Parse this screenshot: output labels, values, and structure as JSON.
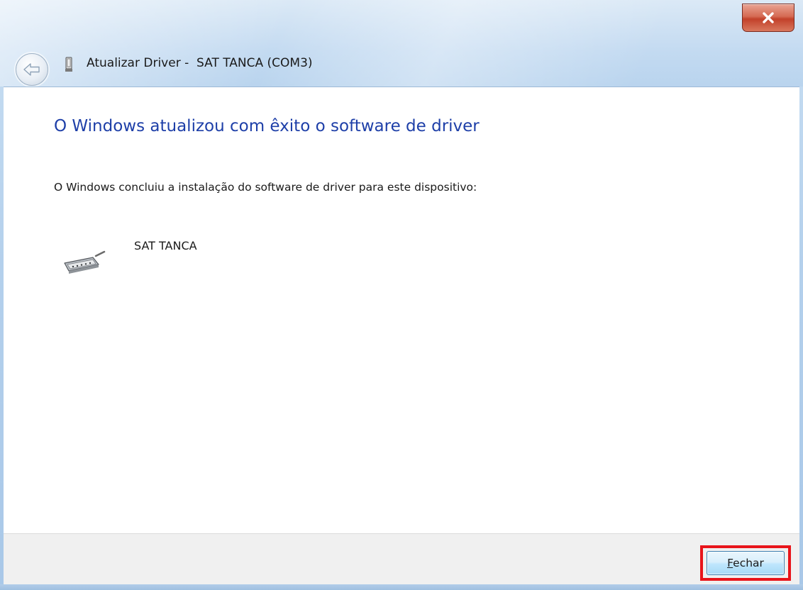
{
  "window": {
    "title": "Atualizar Driver -  SAT TANCA (COM3)"
  },
  "titlebar": {
    "close_icon": "close-icon",
    "back_icon": "back-arrow-icon",
    "device_icon": "usb-device-icon"
  },
  "main": {
    "heading": "O Windows atualizou com êxito o software de driver",
    "message": "O Windows concluiu a instalação do software de driver para este dispositivo:",
    "device": {
      "name": "SAT TANCA",
      "icon": "serial-port-icon"
    }
  },
  "footer": {
    "close_button": {
      "mnemonic": "F",
      "rest": "echar"
    }
  },
  "colors": {
    "heading": "#1e3fa8",
    "highlight": "#e8141a",
    "close_button": "#c2412a"
  }
}
